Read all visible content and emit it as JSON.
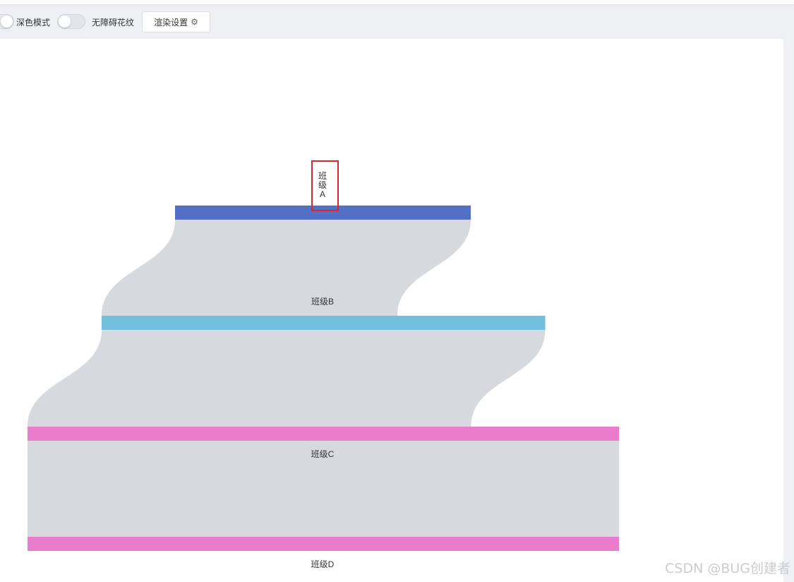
{
  "toolbar": {
    "dark_mode_label": "深色模式",
    "accessible_pattern_label": "无障碍花纹",
    "render_settings_label": "渲染设置",
    "render_settings_icon": "gear-icon"
  },
  "chart_data": {
    "type": "sankey",
    "orientation": "vertical",
    "nodes": [
      {
        "name": "班级A",
        "label": "班级A",
        "color": "#5470c6",
        "value": 2
      },
      {
        "name": "班级B",
        "label": "班级B",
        "color": "#73bfde",
        "value": 3
      },
      {
        "name": "班级C",
        "label": "班级C",
        "color": "#ea7ccc",
        "value": 4
      },
      {
        "name": "班级D",
        "label": "班级D",
        "color": "#ea7ccc",
        "value": 4
      }
    ],
    "links": [
      {
        "source": "班级A",
        "target": "班级B",
        "value": 2
      },
      {
        "source": "班级B",
        "target": "班级C",
        "value": 3
      },
      {
        "source": "班级C",
        "target": "班级D",
        "value": 4
      }
    ],
    "link_color": "#d6d9dd",
    "highlight_annotation": {
      "target": "班级A",
      "color": "#d9262c"
    }
  },
  "watermark": "CSDN @BUG创建者"
}
